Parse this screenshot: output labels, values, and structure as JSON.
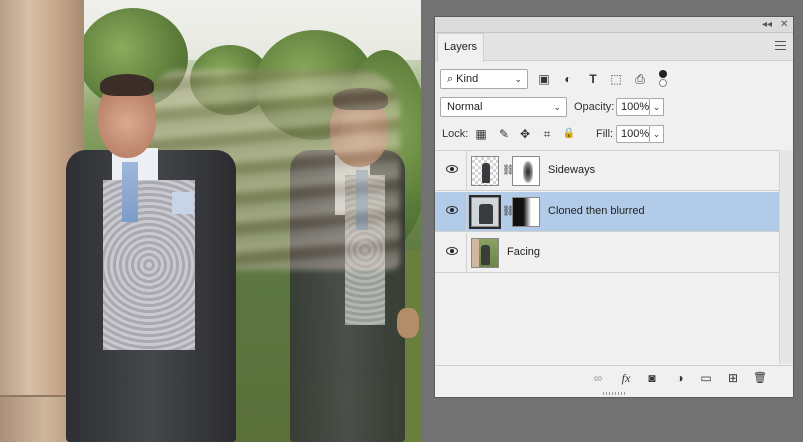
{
  "panel": {
    "tab_label": "Layers",
    "icons": {
      "collapse": "double-chevron-left-icon",
      "close": "close-icon",
      "menu": "hamburger-menu-icon"
    },
    "filter": {
      "kind_label": "Kind",
      "icons": [
        "image-filter-icon",
        "adjustment-filter-icon",
        "type-filter-icon",
        "shape-filter-icon",
        "smart-object-filter-icon",
        "filter-toggle-icon"
      ]
    },
    "blend_mode": "Normal",
    "opacity_label": "Opacity:",
    "opacity_value": "100%",
    "lock_label": "Lock:",
    "fill_label": "Fill:",
    "fill_value": "100%",
    "layers": [
      {
        "name": "Sideways",
        "visible": true,
        "selected": false,
        "has_mask": true
      },
      {
        "name": "Cloned then blurred",
        "visible": true,
        "selected": true,
        "has_mask": true
      },
      {
        "name": "Facing",
        "visible": true,
        "selected": false,
        "has_mask": false
      }
    ],
    "bottom_icons": [
      "link-layers-icon",
      "fx-icon",
      "add-mask-icon",
      "adjustment-layer-icon",
      "folder-icon",
      "new-layer-icon",
      "trash-icon"
    ]
  },
  "glyphs": {
    "collapse": "◂◂",
    "close": "✕",
    "mag": "⌕",
    "chev": "⌄",
    "image": "▣",
    "adjust": "◐",
    "type": "T",
    "shape": "⬚",
    "smart": "⎙",
    "lock_pixels": "▦",
    "lock_paint": "✎",
    "lock_move": "✥",
    "lock_artboard": "⌗",
    "lock_all": "🔒",
    "chain": "⛓",
    "link": "∞",
    "fx": "fx",
    "mask": "◙",
    "adj": "◑",
    "folder": "▭",
    "new": "⊞",
    "trash": "🗑"
  }
}
